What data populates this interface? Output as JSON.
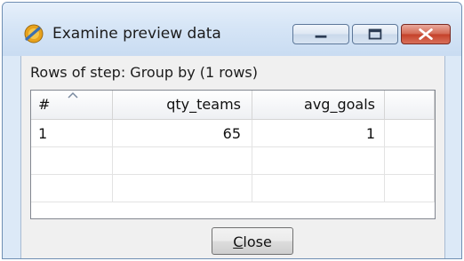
{
  "window": {
    "title": "Examine preview data",
    "icon": "spoon-icon",
    "controls": {
      "minimize_icon": "minimize-icon",
      "maximize_icon": "maximize-icon",
      "close_icon": "close-icon"
    }
  },
  "rows_label": "Rows of step: Group by (1 rows)",
  "table": {
    "columns": [
      "#",
      "qty_teams",
      "avg_goals",
      ""
    ],
    "rows": [
      [
        "1",
        "65",
        "1",
        ""
      ],
      [
        "",
        "",
        "",
        ""
      ],
      [
        "",
        "",
        "",
        ""
      ]
    ],
    "sort_indicator": "sort-ascending-icon"
  },
  "close_button": {
    "mnemonic": "C",
    "rest": "lose"
  },
  "colors": {
    "titlebar": "#d6e5f6",
    "close_control": "#c5412a",
    "client_bg": "#f0f0f0"
  }
}
